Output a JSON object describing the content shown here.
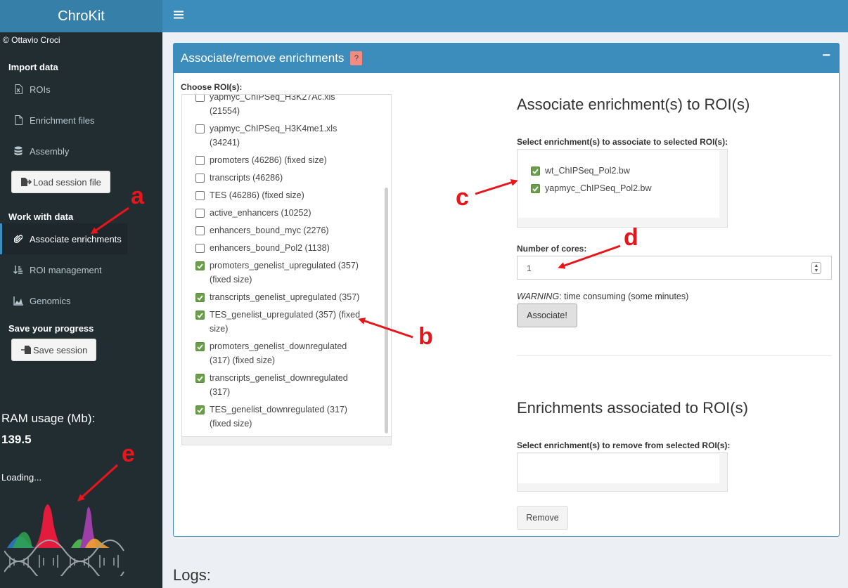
{
  "app": {
    "title": "ChroKit",
    "copyright": "© Ottavio Croci",
    "menu_icon": "hamburger-icon"
  },
  "sidebar": {
    "import_header": "Import data",
    "import_items": [
      {
        "label": "ROIs",
        "icon": "excel-file-icon"
      },
      {
        "label": "Enrichment files",
        "icon": "file-icon"
      },
      {
        "label": "Assembly",
        "icon": "database-icon"
      }
    ],
    "load_session_label": "Load session file",
    "work_header": "Work with data",
    "work_items": [
      {
        "label": "Associate enrichments",
        "icon": "paperclip-icon",
        "active": true
      },
      {
        "label": "ROI management",
        "icon": "sort-icon"
      },
      {
        "label": "Genomics",
        "icon": "area-chart-icon"
      }
    ],
    "save_header": "Save your progress",
    "save_session_label": "Save session",
    "ram_label": "RAM usage (Mb):",
    "ram_value": "139.5",
    "loading_text": "Loading..."
  },
  "panel": {
    "title": "Associate/remove enrichments",
    "help_badge": "?",
    "collapse": "−",
    "choose_label": "Choose ROI(s):",
    "rois": [
      {
        "label": "yapmyc_ChIPSeq_H3K27Ac.xls (21554)",
        "checked": false
      },
      {
        "label": "yapmyc_ChIPSeq_H3K4me1.xls (34241)",
        "checked": false
      },
      {
        "label": "promoters (46286) (fixed size)",
        "checked": false
      },
      {
        "label": "transcripts (46286)",
        "checked": false
      },
      {
        "label": "TES (46286) (fixed size)",
        "checked": false
      },
      {
        "label": "active_enhancers (10252)",
        "checked": false
      },
      {
        "label": "enhancers_bound_myc (2276)",
        "checked": false
      },
      {
        "label": "enhancers_bound_Pol2 (1138)",
        "checked": false
      },
      {
        "label": "promoters_genelist_upregulated (357) (fixed size)",
        "checked": true
      },
      {
        "label": "transcripts_genelist_upregulated (357)",
        "checked": true
      },
      {
        "label": "TES_genelist_upregulated (357) (fixed size)",
        "checked": true
      },
      {
        "label": "promoters_genelist_downregulated (317) (fixed size)",
        "checked": true
      },
      {
        "label": "transcripts_genelist_downregulated (317)",
        "checked": true
      },
      {
        "label": "TES_genelist_downregulated (317) (fixed size)",
        "checked": true
      }
    ],
    "associate_heading": "Associate enrichment(s) to ROI(s)",
    "select_enrich_label": "Select enrichment(s) to associate to selected ROI(s):",
    "enrichments": [
      {
        "label": "wt_ChIPSeq_Pol2.bw",
        "checked": true
      },
      {
        "label": "yapmyc_ChIPSeq_Pol2.bw",
        "checked": true
      }
    ],
    "cores_label": "Number of cores:",
    "cores_value": "1",
    "warning_prefix": "WARNING",
    "warning_text": ": time consuming (some minutes)",
    "associate_button": "Associate!",
    "associated_heading": "Enrichments associated to ROI(s)",
    "remove_label": "Select enrichment(s) to remove from selected ROI(s):",
    "remove_button": "Remove"
  },
  "logs_heading": "Logs:",
  "annotations": {
    "a": "a",
    "b": "b",
    "c": "c",
    "d": "d",
    "e": "e",
    "color": "#e8151b"
  }
}
